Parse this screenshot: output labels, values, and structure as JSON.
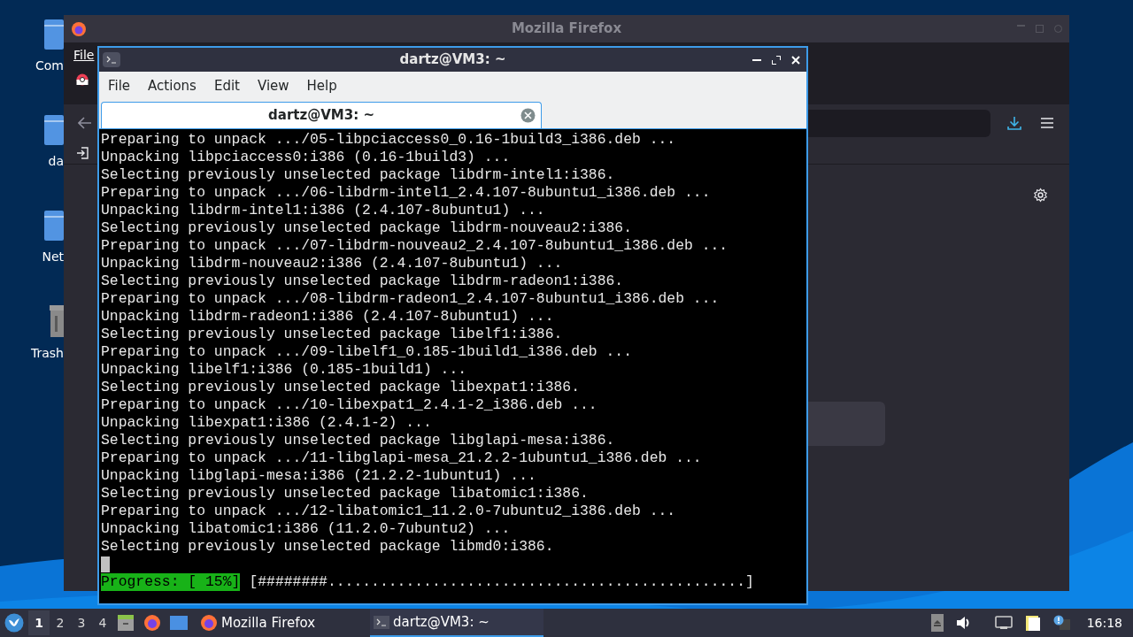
{
  "desktop_icons": [
    {
      "label": "Com"
    },
    {
      "label": "da"
    },
    {
      "label": "Net"
    },
    {
      "label": "Trash"
    }
  ],
  "firefox": {
    "title": "Mozilla Firefox",
    "menu_label": "File"
  },
  "terminal": {
    "title": "dartz@VM3: ~",
    "menu": [
      "File",
      "Actions",
      "Edit",
      "View",
      "Help"
    ],
    "tab": {
      "label": "dartz@VM3: ~",
      "selected": true
    },
    "lines": [
      "Preparing to unpack .../05-libpciaccess0_0.16-1build3_i386.deb ...",
      "Unpacking libpciaccess0:i386 (0.16-1build3) ...",
      "Selecting previously unselected package libdrm-intel1:i386.",
      "Preparing to unpack .../06-libdrm-intel1_2.4.107-8ubuntu1_i386.deb ...",
      "Unpacking libdrm-intel1:i386 (2.4.107-8ubuntu1) ...",
      "Selecting previously unselected package libdrm-nouveau2:i386.",
      "Preparing to unpack .../07-libdrm-nouveau2_2.4.107-8ubuntu1_i386.deb ...",
      "Unpacking libdrm-nouveau2:i386 (2.4.107-8ubuntu1) ...",
      "Selecting previously unselected package libdrm-radeon1:i386.",
      "Preparing to unpack .../08-libdrm-radeon1_2.4.107-8ubuntu1_i386.deb ...",
      "Unpacking libdrm-radeon1:i386 (2.4.107-8ubuntu1) ...",
      "Selecting previously unselected package libelf1:i386.",
      "Preparing to unpack .../09-libelf1_0.185-1build1_i386.deb ...",
      "Unpacking libelf1:i386 (0.185-1build1) ...",
      "Selecting previously unselected package libexpat1:i386.",
      "Preparing to unpack .../10-libexpat1_2.4.1-2_i386.deb ...",
      "Unpacking libexpat1:i386 (2.4.1-2) ...",
      "Selecting previously unselected package libglapi-mesa:i386.",
      "Preparing to unpack .../11-libglapi-mesa_21.2.2-1ubuntu1_i386.deb ...",
      "Unpacking libglapi-mesa:i386 (21.2.2-1ubuntu1) ...",
      "Selecting previously unselected package libatomic1:i386.",
      "Preparing to unpack .../12-libatomic1_11.2.0-7ubuntu2_i386.deb ...",
      "Unpacking libatomic1:i386 (11.2.0-7ubuntu2) ...",
      "Selecting previously unselected package libmd0:i386."
    ],
    "progress": {
      "label": "Progress: [ 15%]",
      "bar": "[########................................................]"
    }
  },
  "taskbar": {
    "workspaces": [
      {
        "label": "1",
        "selected": true
      },
      {
        "label": "2",
        "selected": false
      },
      {
        "label": "3",
        "selected": false
      },
      {
        "label": "4",
        "selected": false
      }
    ],
    "tasks": [
      {
        "label": "Mozilla Firefox",
        "selected": false,
        "kind": "browser"
      },
      {
        "label": "dartz@VM3: ~",
        "selected": true,
        "kind": "terminal"
      }
    ],
    "clock": "16:18"
  }
}
